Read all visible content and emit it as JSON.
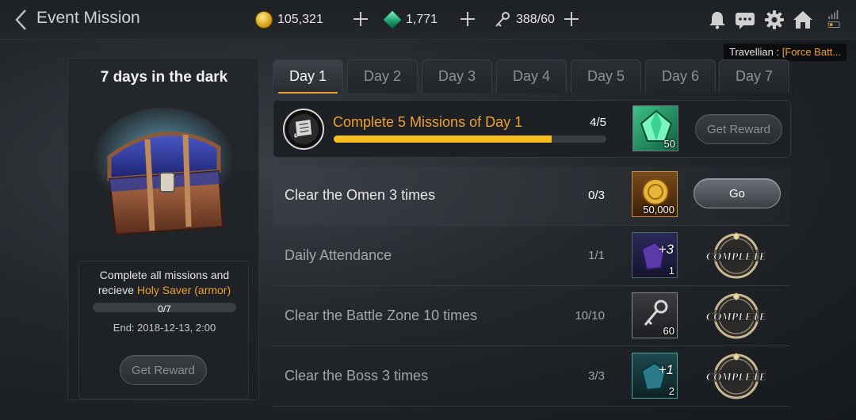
{
  "header": {
    "title": "Event Mission",
    "gold": "105,321",
    "gems": "1,771",
    "stamina": "388/60"
  },
  "tooltip": {
    "prefix": "Travellian : ",
    "name": "[Force Batt..."
  },
  "event": {
    "title": "7 days in the dark",
    "desc_line1": "Complete all missions and",
    "desc_prefix": "recieve ",
    "desc_reward": "Holy Saver (armor)",
    "progress_text": "0/7",
    "progress_fraction": 0,
    "end": "End: 2018-12-13, 2:00",
    "button": "Get Reward"
  },
  "tabs": [
    "Day 1",
    "Day 2",
    "Day 3",
    "Day 4",
    "Day 5",
    "Day 6",
    "Day 7"
  ],
  "active_tab": 0,
  "day_mission": {
    "name": "Complete 5 Missions of Day 1",
    "progress": "4/5",
    "progress_fraction": 0.8,
    "reward_qty": "50",
    "button": "Get Reward"
  },
  "missions": [
    {
      "name": "Clear the Omen 3 times",
      "progress": "0/3",
      "reward_qty": "50,000",
      "reward_plus": "",
      "action": "Go",
      "status": "active"
    },
    {
      "name": "Daily Attendance",
      "progress": "1/1",
      "reward_qty": "1",
      "reward_plus": "+3",
      "action": "COMPLETE",
      "status": "done"
    },
    {
      "name": "Clear the Battle Zone 10 times",
      "progress": "10/10",
      "reward_qty": "60",
      "reward_plus": "",
      "action": "COMPLETE",
      "status": "done"
    },
    {
      "name": "Clear the Boss 3 times",
      "progress": "3/3",
      "reward_qty": "2",
      "reward_plus": "+1",
      "action": "COMPLETE",
      "status": "done"
    }
  ],
  "colors": {
    "accent": "#f0a030",
    "progress": "#f5bd1f",
    "gem": "#1a9b66"
  }
}
